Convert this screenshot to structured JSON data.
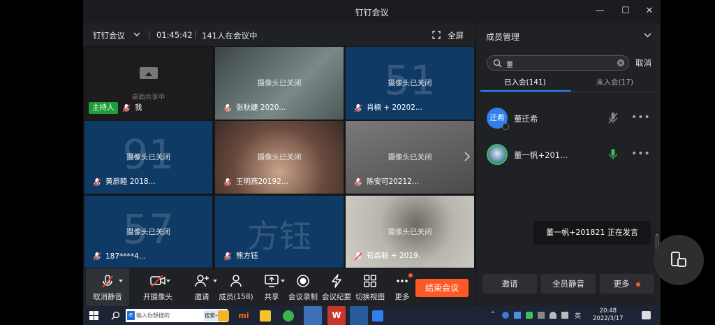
{
  "window": {
    "title": "钉钉会议",
    "minimize": "—",
    "maximize": "☐",
    "close": "✕"
  },
  "meeting": {
    "name": "钉钉会议",
    "duration": "01:45:42",
    "attendee_text": "141人在会议中",
    "fullscreen_label": "全屏"
  },
  "grid": {
    "camera_off": "摄像头已关闭",
    "screen_share_label": "桌面共享中",
    "host_badge": "主持人",
    "tiles": [
      {
        "name": "我",
        "big": "",
        "bg": "#1c1c1c"
      },
      {
        "name": "张秋婕 2020...",
        "big": "",
        "bg": "#5b6a6c"
      },
      {
        "name": "肖楠 + 20202...",
        "big": "51",
        "bg": "#0f3a66"
      },
      {
        "name": "黄原睦 2018...",
        "big": "91",
        "bg": "#0f3a66"
      },
      {
        "name": "王明燕20192...",
        "big": "",
        "bg": "#6a4a3e"
      },
      {
        "name": "陈安可20212...",
        "big": "",
        "bg": "#5e5e5e"
      },
      {
        "name": "187****4...",
        "big": "57",
        "bg": "#0f3a66"
      },
      {
        "name": "熊方钰",
        "big": "方钰",
        "bg": "#0f3a66"
      },
      {
        "name": "荀森聪 + 2019.",
        "big": "",
        "bg": "#a8a69e"
      }
    ]
  },
  "toolbar": {
    "unmute": "取消静音",
    "camera": "开摄像头",
    "invite": "邀请",
    "members": "成员(158)",
    "share": "共享",
    "record": "会议录制",
    "summary": "会议纪要",
    "switch_view": "切换视图",
    "more": "更多",
    "end": "结束会议"
  },
  "panel": {
    "title": "成员管理",
    "search_value": "董",
    "cancel": "取消",
    "tab_joined": "已入会(141)",
    "tab_not_joined": "未入会(17)",
    "members": [
      {
        "name": "董迁希",
        "avatar_text": "迁希",
        "avatar_color": "#2f80ed",
        "mic": "muted"
      },
      {
        "name": "董一帆+201...",
        "avatar_text": "",
        "avatar_color": "#3a6a8a",
        "mic": "active"
      }
    ],
    "more_dots": "•••",
    "speaking_toast": "董一帆+201821  正在发言",
    "invite_btn": "邀请",
    "mute_all_btn": "全员静音",
    "more_btn": "更多"
  },
  "taskbar": {
    "search_placeholder": "输入你想搜的",
    "search_button": "搜索一下",
    "ime": "英",
    "time": "20:48",
    "date": "2022/3/17"
  },
  "colors": {
    "accent_blue": "#2a7cf6",
    "end_orange": "#ff5a26",
    "host_green": "#1e9e3a",
    "mic_green": "#3dbf5b"
  }
}
